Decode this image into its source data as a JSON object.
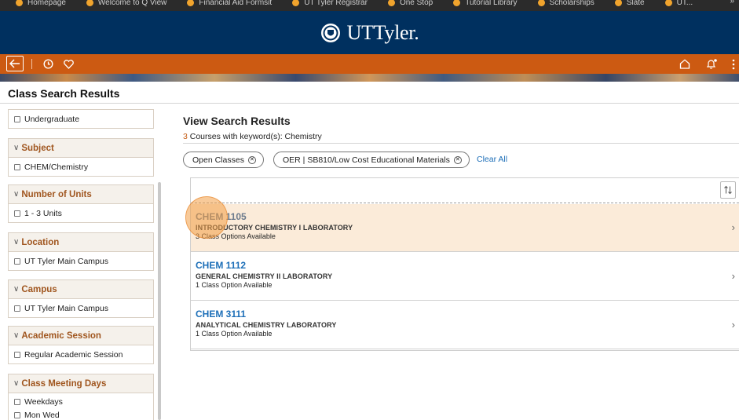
{
  "browser": {
    "bookmarks": [
      "Homepage",
      "Welcome to Q View",
      "Financial Aid Formsit",
      "UT Tyler Registrar",
      "One Stop",
      "Tutorial Library",
      "Scholarships",
      "Slate",
      "UT..."
    ],
    "more_label": "»"
  },
  "header": {
    "brand_name": "UTTyler.",
    "seal_icon": "university-seal-icon"
  },
  "navbar": {
    "back_icon": "back-arrow-icon",
    "history_icon": "clock-icon",
    "favorites_icon": "heart-icon",
    "home_icon": "home-icon",
    "notifications_icon": "bell-icon"
  },
  "page": {
    "title": "Class Search Results"
  },
  "sidebar": {
    "facets": [
      {
        "heading": "",
        "options": [
          "Undergraduate"
        ]
      },
      {
        "heading": "Subject",
        "options": [
          "CHEM/Chemistry"
        ]
      },
      {
        "heading": "Number of Units",
        "options": [
          "1 - 3 Units"
        ]
      },
      {
        "heading": "Location",
        "options": [
          "UT Tyler Main Campus"
        ]
      },
      {
        "heading": "Campus",
        "options": [
          "UT Tyler Main Campus"
        ]
      },
      {
        "heading": "Academic Session",
        "options": [
          "Regular Academic Session"
        ]
      },
      {
        "heading": "Class Meeting Days",
        "options": [
          "Weekdays",
          "Mon Wed"
        ]
      }
    ]
  },
  "main": {
    "title": "View Search Results",
    "result_count": "3",
    "keyword_text": " Courses with keyword(s): Chemistry",
    "filters": [
      "Open Classes",
      "OER | SB810/Low Cost Educational Materials"
    ],
    "clear_all": "Clear All",
    "sort_icon": "sort-arrows-icon",
    "courses": [
      {
        "code": "CHEM 1105",
        "name": "INTRODUCTORY CHEMISTRY I LABORATORY",
        "options": "3 Class Options Available"
      },
      {
        "code": "CHEM 1112",
        "name": "GENERAL CHEMISTRY II LABORATORY",
        "options": "1 Class Option Available"
      },
      {
        "code": "CHEM 3111",
        "name": "ANALYTICAL CHEMISTRY LABORATORY",
        "options": "1 Class Option Available"
      }
    ]
  },
  "colors": {
    "brand_navy": "#00305f",
    "nav_orange": "#cc5a12",
    "link_blue": "#1d6fb8",
    "facet_heading": "#a0561f",
    "selected_row": "#fbebd9"
  }
}
